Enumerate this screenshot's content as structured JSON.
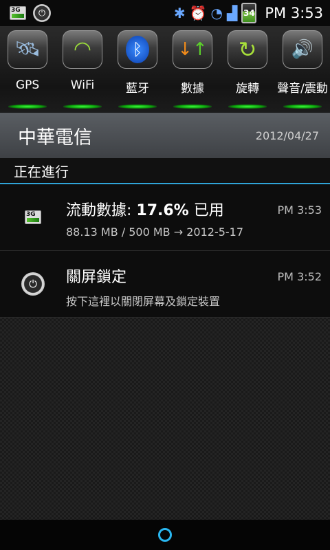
{
  "status_bar": {
    "network_badge": "3G",
    "icons": [
      "3g-data-icon",
      "power-lock-icon",
      "bluetooth-icon",
      "alarm-clock-icon",
      "wifi-icon",
      "signal-strength-icon",
      "battery-icon"
    ],
    "battery_level": "34",
    "time": "PM 3:53"
  },
  "toggles": [
    {
      "label": "GPS",
      "icon": "gps-satellite-icon"
    },
    {
      "label": "WiFi",
      "icon": "wifi-icon"
    },
    {
      "label": "藍牙",
      "icon": "bluetooth-icon"
    },
    {
      "label": "數據",
      "icon": "data-transfer-icon"
    },
    {
      "label": "旋轉",
      "icon": "rotate-icon"
    },
    {
      "label": "聲音/震動",
      "icon": "sound-vibrate-icon"
    }
  ],
  "carrier": {
    "name": "中華電信",
    "date": "2012/04/27"
  },
  "ongoing": {
    "header": "正在進行",
    "items": [
      {
        "title_prefix": "流動數據: ",
        "title_emphasis": "17.6%",
        "title_suffix": " 已用",
        "subtitle": "88.13 MB / 500 MB → 2012-5-17",
        "time": "PM 3:53",
        "icon": "3g-data-icon",
        "icon_badge": "3G"
      },
      {
        "title_prefix": "關屏鎖定",
        "subtitle": "按下這裡以關閉屏幕及鎖定裝置",
        "time": "PM 3:52",
        "icon": "power-lock-icon"
      }
    ]
  },
  "accent_color": "#2fa4d8",
  "toggle_glow_color": "#3dff3d"
}
